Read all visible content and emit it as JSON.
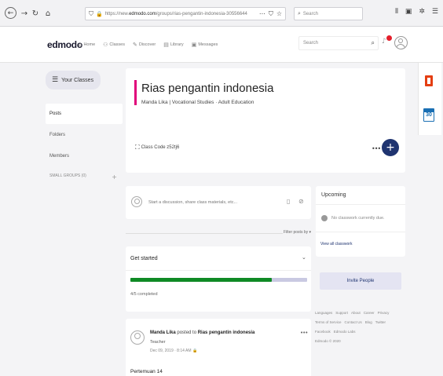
{
  "browser": {
    "url_prefix": "https://new.",
    "url_host": "edmodo.com",
    "url_path": "/groups/rias-pengantin-indonesia-30556644",
    "search_placeholder": "Search",
    "icons": [
      "back-icon",
      "forward-icon",
      "reload-icon",
      "home-icon",
      "shield-icon",
      "lock-icon",
      "page-actions-icon",
      "bookmark-icon",
      "star-icon",
      "library-icon",
      "sidebar-icon",
      "extension-icon",
      "menu-icon"
    ]
  },
  "app": {
    "logo": "edmodo",
    "nav": [
      {
        "label": "Home",
        "icon": "home-icon"
      },
      {
        "label": "Classes",
        "icon": "classes-icon"
      },
      {
        "label": "Discover",
        "icon": "discover-icon"
      },
      {
        "label": "Library",
        "icon": "library-icon"
      },
      {
        "label": "Messages",
        "icon": "messages-icon"
      }
    ],
    "search_placeholder": "Search"
  },
  "sidebar": {
    "your_classes": "Your Classes",
    "items": [
      "Posts",
      "Folders",
      "Members"
    ],
    "small_groups": "SMALL GROUPS (0)"
  },
  "class": {
    "title": "Rias pengantin indonesia",
    "subtitle": "Manda Lika | Vocational Studies · Adult Education",
    "code_label": "Class Code z52tj6"
  },
  "composer": {
    "placeholder": "Start a discussion, share class materials, etc..."
  },
  "filter_label": "Filter posts by ▾",
  "get_started": {
    "title": "Get started",
    "progress": 0.8,
    "completed": "4/5 completed"
  },
  "post": {
    "author": "Manda Lika",
    "posted_to": "posted to",
    "group": "Rias pengantin indonesia",
    "role": "Teacher",
    "date": "Dec 09, 2019 · 8:14 AM",
    "body": "Pertemuan 14"
  },
  "upcoming": {
    "title": "Upcoming",
    "empty": "No classwork currently due.",
    "link": "View all classwork"
  },
  "invite_label": "Invite People",
  "footer": {
    "links": [
      "Languages",
      "Support",
      "About",
      "Career",
      "Privacy",
      "Terms of Service",
      "Contact Us",
      "Blog",
      "Twitter",
      "Facebook",
      "Edmodo Labs"
    ],
    "copyright": "Edmodo © 2020"
  },
  "side_apps": {
    "calendar_day": "30"
  },
  "colors": {
    "accent_bar": "#e1007a",
    "fab": "#1f3470",
    "progress": "#0f8a25",
    "notification": "#e41e2b"
  }
}
